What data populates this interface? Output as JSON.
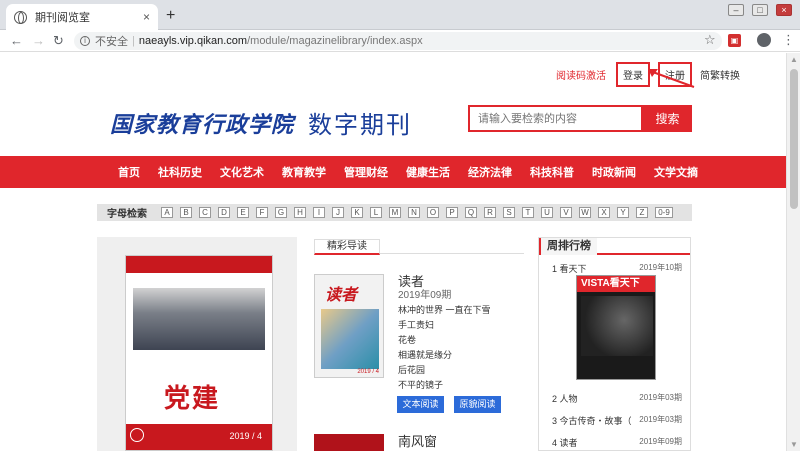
{
  "browser": {
    "tab_title": "期刊阅览室",
    "tab_close": "×",
    "new_tab": "+",
    "not_secure": "不安全",
    "url_host": "naeayls.vip.qikan.com",
    "url_path": "/module/magazinelibrary/index.aspx"
  },
  "header": {
    "activate": "阅读码激活",
    "login": "登录",
    "register": "注册",
    "lang": "简繁转换",
    "logo_text": "国家教育行政学院",
    "logo_sub": "数字期刊",
    "search_placeholder": "请输入要检索的内容",
    "search_button": "搜索"
  },
  "menu": [
    "首页",
    "社科历史",
    "文化艺术",
    "教育教学",
    "管理财经",
    "健康生活",
    "经济法律",
    "科技科普",
    "时政新闻",
    "文学文摘"
  ],
  "alpha": {
    "label": "字母检索",
    "letters": [
      "A",
      "B",
      "C",
      "D",
      "E",
      "F",
      "G",
      "H",
      "I",
      "J",
      "K",
      "L",
      "M",
      "N",
      "O",
      "P",
      "Q",
      "R",
      "S",
      "T",
      "U",
      "V",
      "W",
      "X",
      "Y",
      "Z",
      "0-9"
    ]
  },
  "cover": {
    "title": "党建",
    "issue": "2019 / 4"
  },
  "featured": {
    "heading": "精彩导读",
    "mag1": {
      "name": "读者",
      "issue": "2019年09期",
      "articles": [
        "林冲的世界 一直在下雪",
        "手工贵妇",
        "花卷",
        "相遇就是缘分",
        "后花园",
        "不平的镜子"
      ]
    },
    "text_read": "文本阅读",
    "orig_read": "原貌阅读",
    "mag2_name": "南风窗"
  },
  "weekly": {
    "heading": "周排行榜",
    "items": [
      {
        "rank": "1 看天下",
        "date": "2019年10期"
      },
      {
        "rank": "2 人物",
        "date": "2019年03期"
      },
      {
        "rank": "3 今古传奇・故事（",
        "date": "2019年03期"
      },
      {
        "rank": "4 读者",
        "date": "2019年09期"
      }
    ],
    "cover_name": "VISTA看天下"
  }
}
